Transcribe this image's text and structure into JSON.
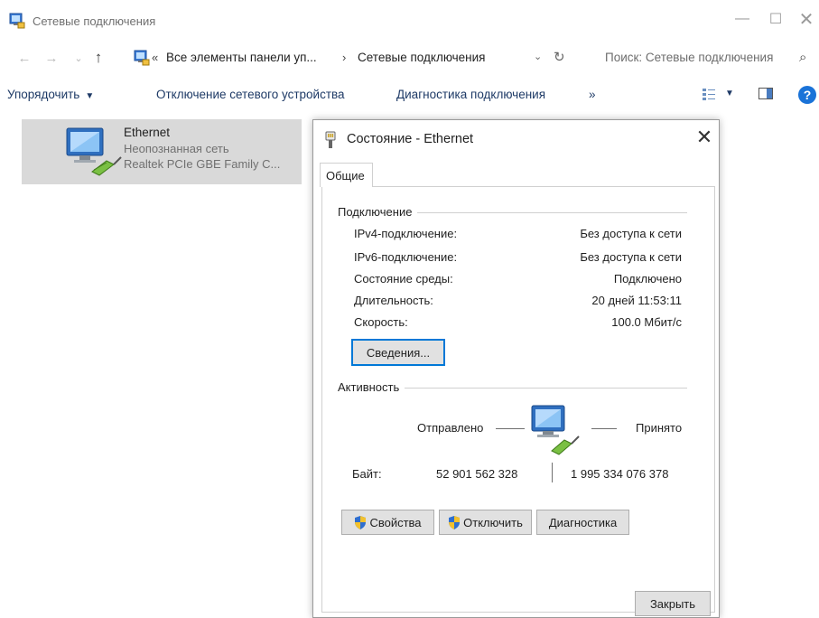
{
  "window": {
    "title": "Сетевые подключения",
    "controls": {
      "minimize": "—",
      "maximize": "☐",
      "close": "✕"
    }
  },
  "address": {
    "back": "←",
    "forward": "→",
    "history": "⌄",
    "up": "↑",
    "overflow": "«",
    "crumb1": "Все элементы панели уп...",
    "separator": "›",
    "crumb2": "Сетевые подключения",
    "dropdown": "⌄",
    "refresh": "↻",
    "search_placeholder": "Поиск: Сетевые подключения",
    "search_glyph": "⌕"
  },
  "toolbar": {
    "organize": "Упорядочить",
    "disable_device": "Отключение сетевого устройства",
    "diagnose": "Диагностика подключения",
    "more": "»",
    "help": "?"
  },
  "connection": {
    "name": "Ethernet",
    "status": "Неопознанная сеть",
    "adapter": "Realtek PCIe GBE Family C..."
  },
  "dialog": {
    "title": "Состояние - Ethernet",
    "close_glyph": "✕",
    "tab": "Общие",
    "connection_group": "Подключение",
    "rows": [
      {
        "label": "IPv4-подключение:",
        "value": "Без доступа к сети"
      },
      {
        "label": "IPv6-подключение:",
        "value": "Без доступа к сети"
      },
      {
        "label": "Состояние среды:",
        "value": "Подключено"
      },
      {
        "label": "Длительность:",
        "value": "20 дней 11:53:11"
      },
      {
        "label": "Скорость:",
        "value": "100.0 Мбит/с"
      }
    ],
    "details_button": "Сведения...",
    "activity_group": "Активность",
    "sent_label": "Отправлено",
    "received_label": "Принято",
    "bytes_label": "Байт:",
    "bytes_sent": "52 901 562 328",
    "bytes_received": "1 995 334 076 378",
    "properties_button": "Свойства",
    "disable_button": "Отключить",
    "diagnose_button": "Диагностика",
    "close_button": "Закрыть"
  },
  "colors": {
    "toolbar_text": "#1e3a66",
    "selection": "#d9d9d9",
    "focus": "#0078d7",
    "button_face": "#e1e1e1",
    "help_blue": "#1a73d8"
  }
}
